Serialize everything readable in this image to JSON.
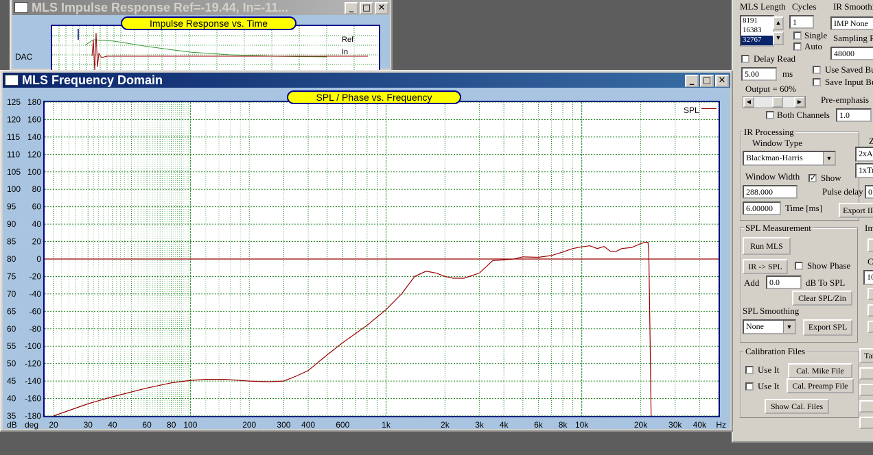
{
  "impulse_window": {
    "title": "MLS Impulse Response  Ref=-19.44, In=-11...",
    "chart_title": "Impulse Response vs. Time",
    "y_label": "DAC",
    "legend": [
      "Ref",
      "In"
    ],
    "legend_colors": [
      "#3a6ea5",
      "#990000"
    ]
  },
  "freq_window": {
    "title": "MLS Frequency Domain",
    "chart_title": "SPL / Phase vs. Frequency",
    "db_labels": [
      "125",
      "120",
      "115",
      "110",
      "105",
      "100",
      "95",
      "90",
      "85",
      "80",
      "75",
      "70",
      "65",
      "60",
      "55",
      "50",
      "45",
      "40",
      "35"
    ],
    "deg_labels": [
      "180",
      "160",
      "140",
      "120",
      "100",
      "80",
      "60",
      "40",
      "20",
      "0",
      "-20",
      "-40",
      "-60",
      "-80",
      "-100",
      "-120",
      "-140",
      "-160",
      "-180"
    ],
    "x_labels": [
      "20",
      "30",
      "40",
      "60",
      "80",
      "100",
      "200",
      "300",
      "400",
      "600",
      "1k",
      "2k",
      "3k",
      "4k",
      "6k",
      "8k",
      "10k",
      "20k",
      "30k",
      "40k"
    ],
    "x_unit": "Hz",
    "y_unit_db": "dB",
    "y_unit_deg": "deg",
    "legend": "SPL"
  },
  "chart_data": {
    "type": "line",
    "title": "SPL / Phase vs. Frequency",
    "xlabel": "Hz",
    "ylabel": "dB",
    "x_scale": "log",
    "xlim": [
      18,
      50000
    ],
    "ylim": [
      35,
      125
    ],
    "ylim_secondary": [
      -180,
      180
    ],
    "grid": true,
    "legend_position": "top-right",
    "series": [
      {
        "name": "SPL",
        "color": "#990000",
        "x": [
          20,
          30,
          40,
          60,
          80,
          100,
          120,
          150,
          200,
          250,
          300,
          350,
          400,
          500,
          600,
          800,
          1000,
          1200,
          1400,
          1600,
          1800,
          2000,
          2200,
          2500,
          3000,
          3500,
          4000,
          4500,
          5000,
          6000,
          7000,
          8000,
          9000,
          10000,
          11000,
          12000,
          13000,
          14000,
          15000,
          16000,
          18000,
          20000,
          21000,
          21800,
          22000,
          22300,
          22600
        ],
        "y": [
          35,
          38.5,
          40.5,
          43,
          44.5,
          45.2,
          45.5,
          45.5,
          45,
          44.8,
          45,
          46.5,
          48,
          52.5,
          56,
          61,
          65.5,
          70,
          75,
          76.5,
          76,
          75,
          74.5,
          74.5,
          76,
          79.5,
          79.8,
          80,
          80.6,
          80.5,
          81,
          82,
          83,
          83.5,
          83.8,
          83,
          83.6,
          82.2,
          82.2,
          83,
          83.3,
          84.4,
          84.8,
          84.8,
          82,
          60,
          35
        ]
      },
      {
        "name": "Phase",
        "color": "#990000",
        "x": [
          18,
          50000
        ],
        "y": [
          80,
          80
        ]
      }
    ]
  },
  "panel": {
    "mls_length_label": "MLS Length",
    "cycles_label": "Cycles",
    "ir_smoothing_label": "IR Smoothi",
    "mls_options": [
      "8191",
      "16383",
      "32767"
    ],
    "mls_selected": "32767",
    "cycles_value": "1",
    "single_label": "Single",
    "auto_label": "Auto",
    "ir_smoothing_value": "IMP None",
    "sampling_rate_label": "Sampling R",
    "sampling_rate_value": "48000",
    "delay_read_label": "Delay Read",
    "delay_value": "5.00",
    "ms_label": "ms",
    "use_saved_label": "Use Saved Bu",
    "save_input_label": "Save Input Bu",
    "output_label": "Output = 60%",
    "output_level": 0.6,
    "pre_emphasis_label": "Pre-emphasis",
    "both_channels_label": "Both Channels",
    "pre_emphasis_value": "1.0",
    "ir_processing_title": "IR Processing",
    "window_type_label": "Window Type",
    "window_type_value": "Blackman-Harris",
    "z_label": "Z",
    "z_opt1": "2xA",
    "z_opt2": "1xTr",
    "window_width_label": "Window Width",
    "show_label": "Show",
    "window_width_value": "288.000",
    "pulse_delay_label": "Pulse delay",
    "pulse_delay_value": "0",
    "time_value": "6.00000",
    "time_label": "Time [ms]",
    "export_ir_label": "Export II",
    "spl_measurement_title": "SPL Measurement",
    "im_title": "Im",
    "run_mls_label": "Run MLS",
    "ir_to_spl_label": "IR -> SPL",
    "show_phase_label": "Show Phase",
    "ca_label": "Ca",
    "add_label": "Add",
    "add_value": "0.0",
    "db_to_spl_label": "dB  To SPL",
    "ca_value": "10",
    "clear_label": "Clear SPL/Zin",
    "spl_smoothing_label": "SPL Smoothing",
    "spl_smoothing_value": "None",
    "export_spl_label": "Export SPL",
    "calibration_title": "Calibration Files",
    "tar_label": "Tar",
    "use_it_label": "Use It",
    "cal_mike_label": "Cal. Mike File",
    "cal_preamp_label": "Cal. Preamp File",
    "show_cal_label": "Show Cal. Files"
  }
}
